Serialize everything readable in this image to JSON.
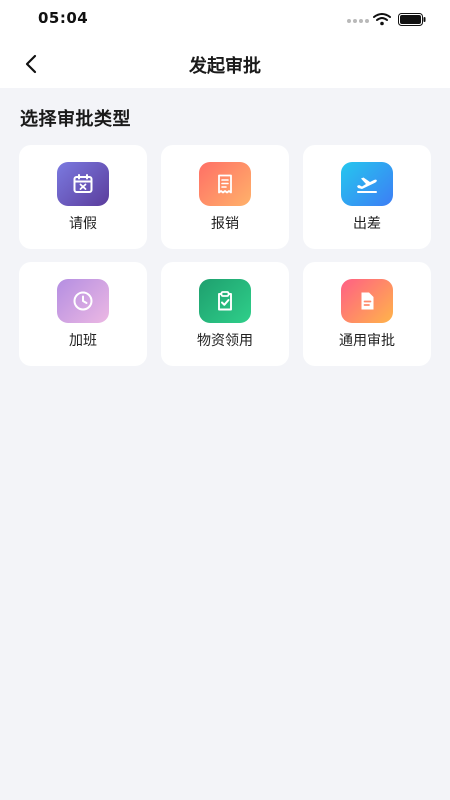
{
  "status_bar": {
    "time": "05:04"
  },
  "nav": {
    "title": "发起审批"
  },
  "section": {
    "title": "选择审批类型"
  },
  "approval_types": [
    {
      "label": "请假",
      "icon": "calendar-cross-icon"
    },
    {
      "label": "报销",
      "icon": "receipt-icon"
    },
    {
      "label": "出差",
      "icon": "airplane-departure-icon"
    },
    {
      "label": "加班",
      "icon": "clock-icon"
    },
    {
      "label": "物资领用",
      "icon": "clipboard-check-icon"
    },
    {
      "label": "通用审批",
      "icon": "document-icon"
    }
  ],
  "colors": {
    "background": "#f3f4f8",
    "card": "#ffffff",
    "leave": [
      "#7b7ae0",
      "#5b3c9c"
    ],
    "reimburse": [
      "#ff6f66",
      "#ffb26a"
    ],
    "trip": [
      "#25c7ee",
      "#3d7df5"
    ],
    "overtime": [
      "#b48ee2",
      "#ecb8e3"
    ],
    "material": [
      "#1e9f6e",
      "#2fcf8a"
    ],
    "general": [
      "#ff5f85",
      "#ffb44a"
    ]
  }
}
